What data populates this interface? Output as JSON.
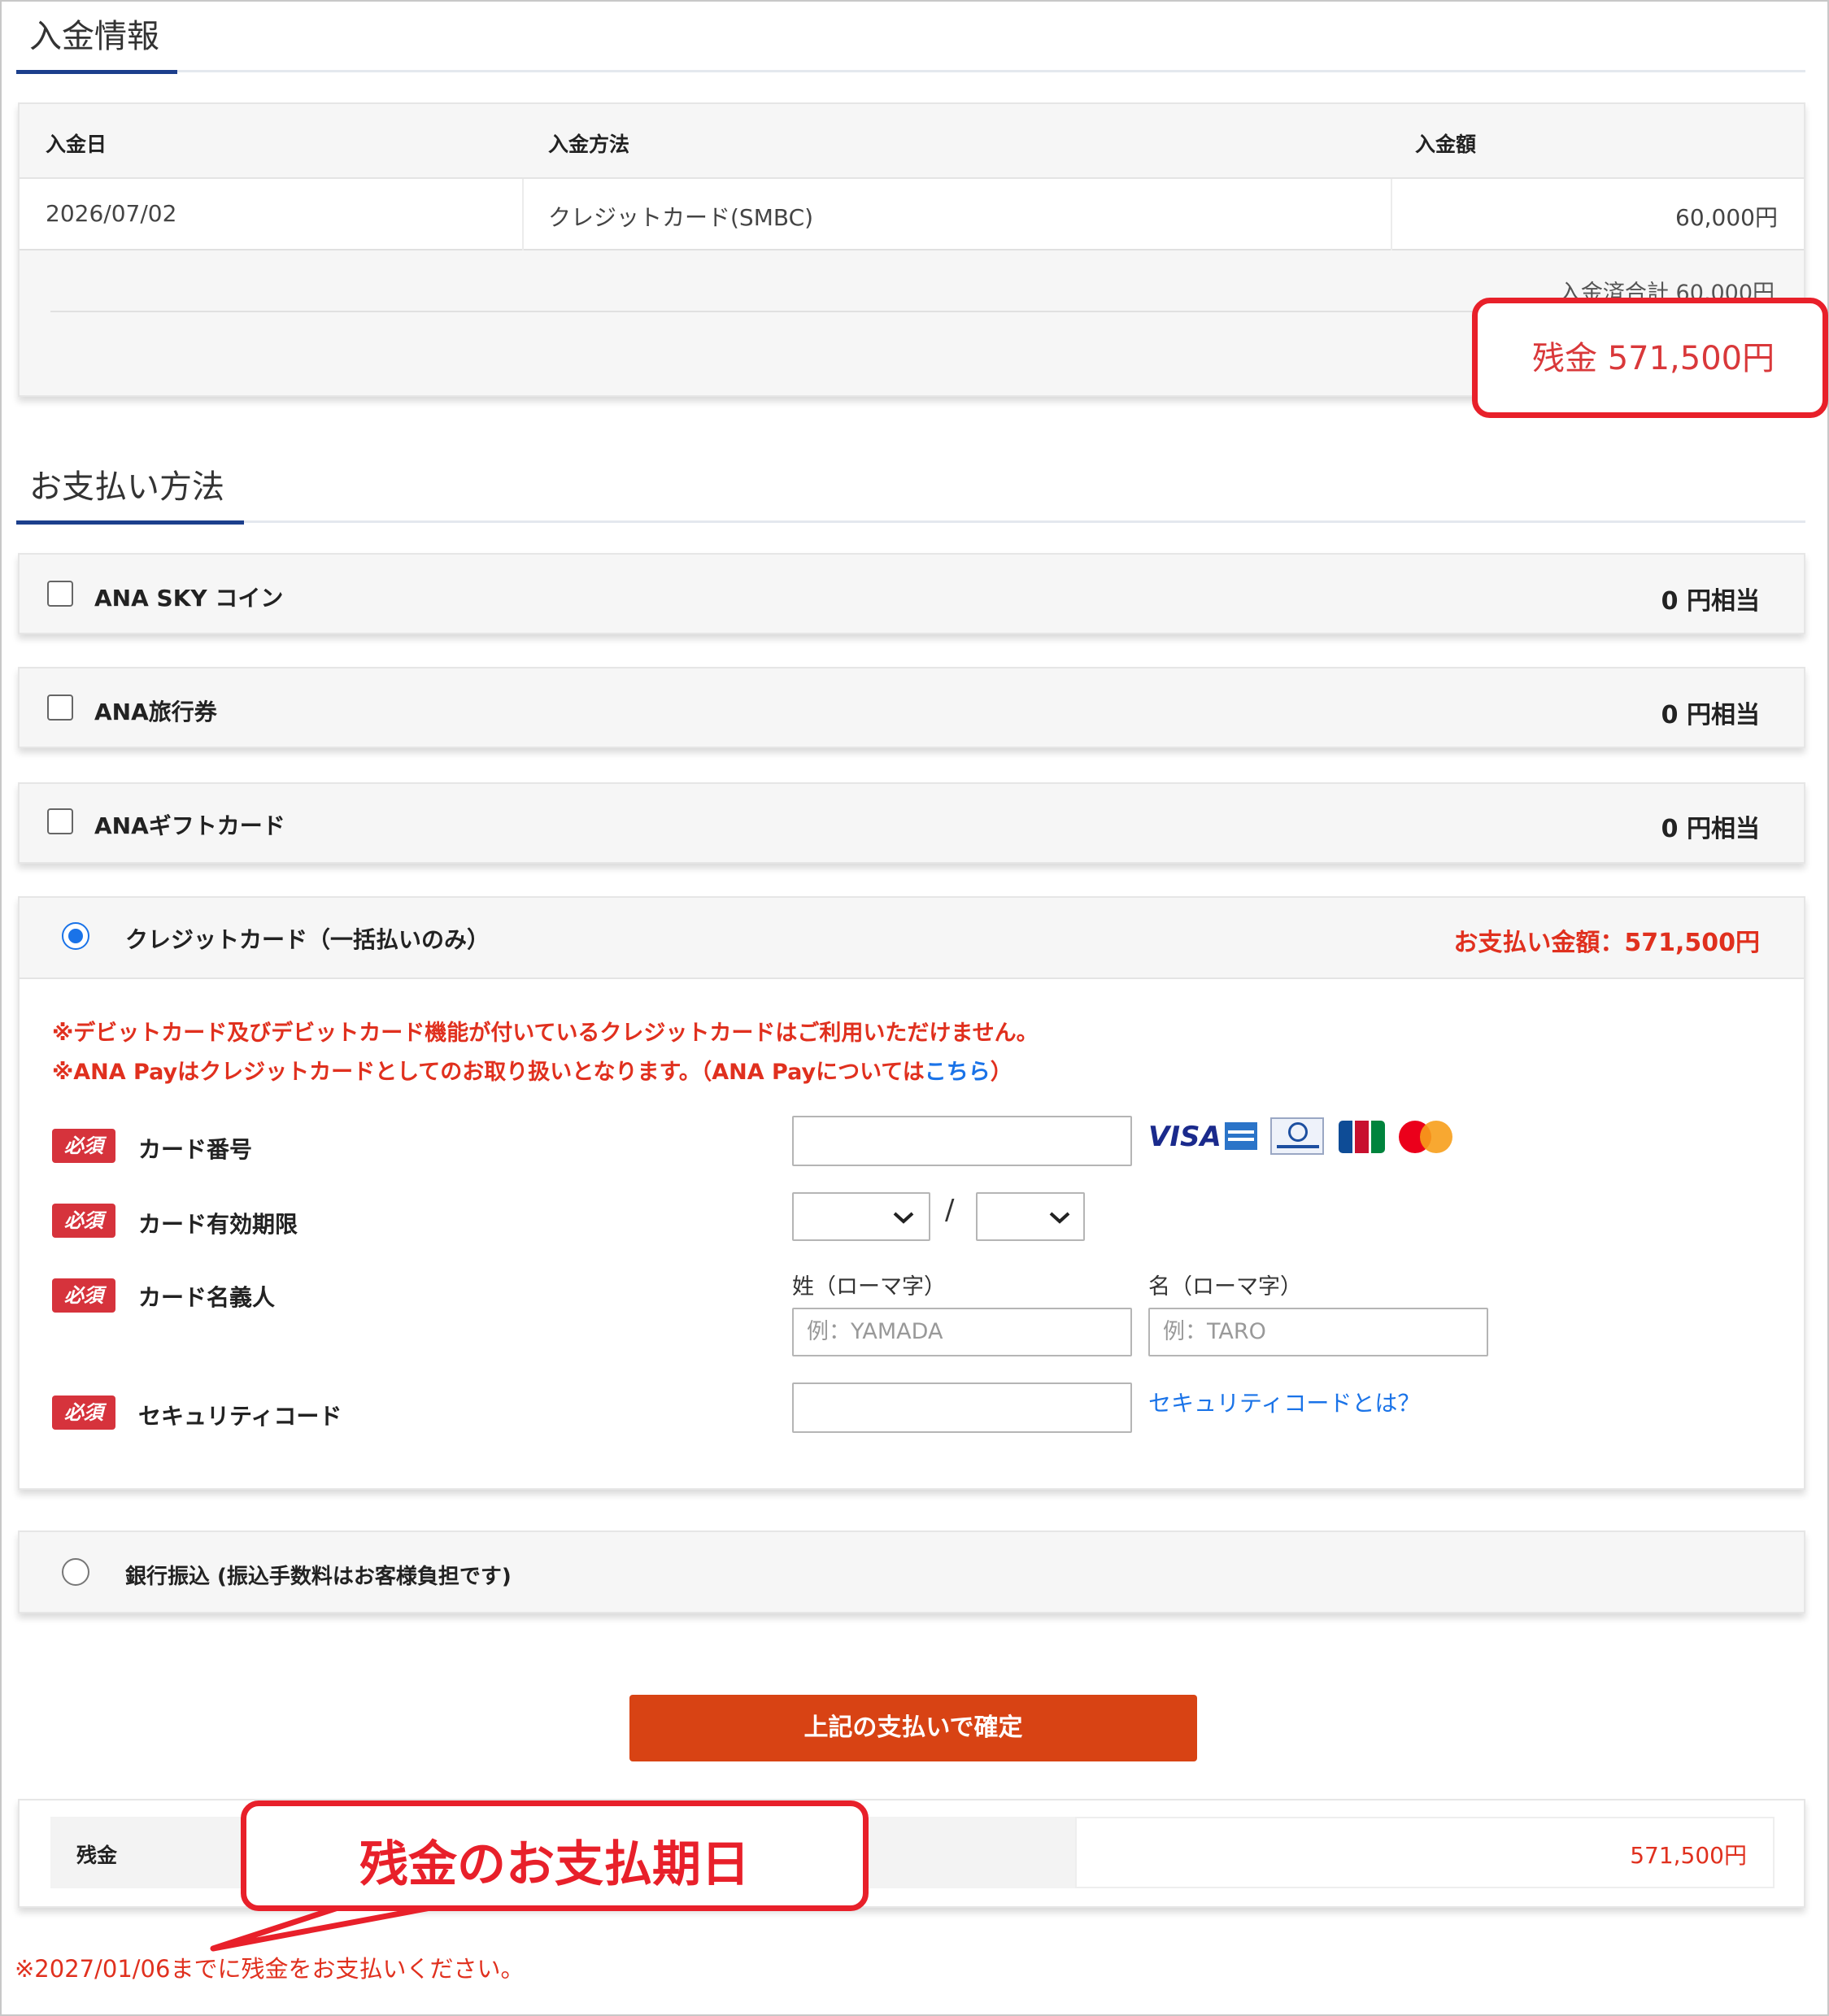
{
  "deposit_section": {
    "title": "入金情報",
    "table": {
      "headers": [
        "入金日",
        "入金方法",
        "入金額"
      ],
      "rows": [
        {
          "date": "2026/07/02",
          "method": "クレジットカード(SMBC)",
          "amount": "60,000円"
        }
      ],
      "total_label": "入金済合計 60,000円",
      "balance_label": "残金 571,500円"
    }
  },
  "payment_section": {
    "title": "お支払い方法",
    "options": [
      {
        "label": "ANA SKY コイン",
        "amount": "0 円相当"
      },
      {
        "label": "ANA旅行券",
        "amount": "0 円相当"
      },
      {
        "label": "ANAギフトカード",
        "amount": "0 円相当"
      }
    ],
    "credit_card": {
      "label": "クレジットカード（一括払いのみ）",
      "amount": "お支払い金額：571,500円",
      "notice1": "※デビットカード及びデビットカード機能が付いているクレジットカードはご利用いただけません。",
      "notice2_prefix": "※ANA Payはクレジットカードとしてのお取り扱いとなります。（ANA Payについては",
      "notice2_link": "こちら",
      "notice2_suffix": "）",
      "required_badge": "必須",
      "fields": {
        "card_number": "カード番号",
        "expiry": "カード有効期限",
        "expiry_separator": "/",
        "holder": "カード名義人",
        "last_name_label": "姓（ローマ字）",
        "last_name_placeholder": "例：YAMADA",
        "first_name_label": "名（ローマ字）",
        "first_name_placeholder": "例：TARO",
        "security_code": "セキュリティコード",
        "security_help_link": "セキュリティコードとは？"
      },
      "brands": [
        {
          "name": "VISA",
          "icon": "visa-logo-icon"
        },
        {
          "name": "AMEX",
          "icon": "amex-logo-icon"
        },
        {
          "name": "Diners Club",
          "icon": "diners-logo-icon"
        },
        {
          "name": "JCB",
          "icon": "jcb-logo-icon"
        },
        {
          "name": "Mastercard",
          "icon": "mastercard-logo-icon"
        }
      ]
    },
    "bank_transfer": {
      "label": "銀行振込 (振込手数料はお客様負担です)"
    },
    "confirm_button": "上記の支払いで確定"
  },
  "balance_summary": {
    "label": "残金",
    "amount": "571,500円",
    "due_note": "※2027/01/06までに残金をお支払いください。"
  },
  "annotation": {
    "callout_text": "残金のお支払期日"
  },
  "colors": {
    "accent_blue": "#1c3f8c",
    "alert_red": "#e0301e",
    "annotation_red": "#e8202a",
    "confirm_orange": "#d84314",
    "link_blue": "#1a73e8"
  }
}
